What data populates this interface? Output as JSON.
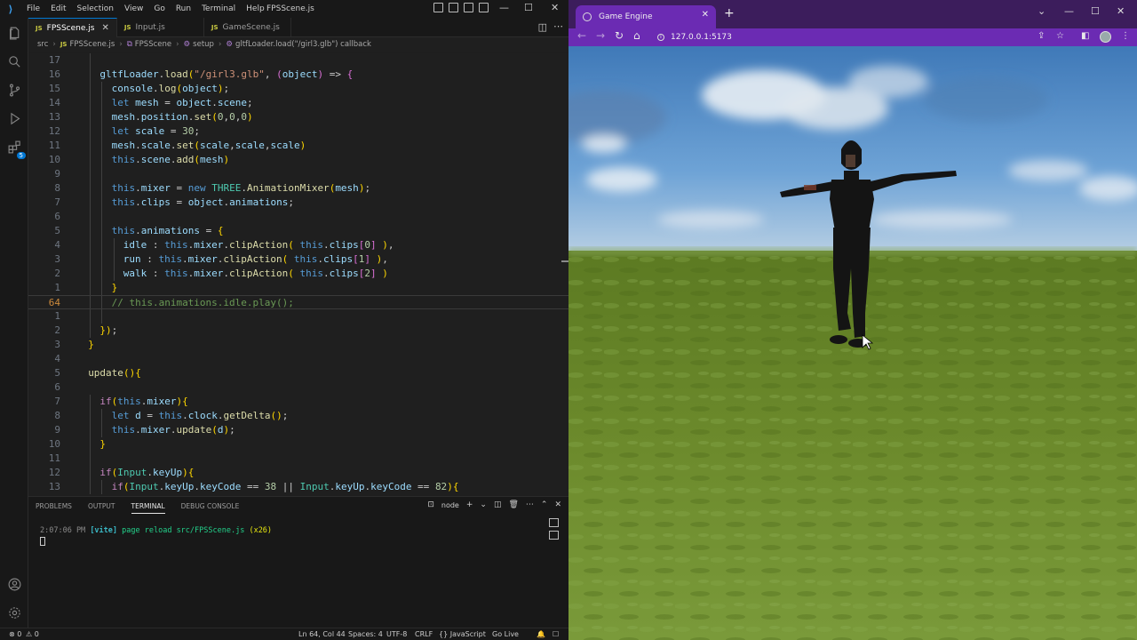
{
  "vscode": {
    "menu": [
      "File",
      "Edit",
      "Selection",
      "View",
      "Go",
      "Run",
      "Terminal",
      "Help"
    ],
    "window_title": "FPSScene.js",
    "tabs": [
      {
        "icon": "JS",
        "label": "FPSScene.js",
        "close": "✕"
      },
      {
        "icon": "JS",
        "label": "Input.js"
      },
      {
        "icon": "JS",
        "label": "GameScene.js"
      }
    ],
    "breadcrumb": {
      "folder": "src",
      "file_icon": "JS",
      "file": "FPSScene.js",
      "class": "FPSScene",
      "method": "setup",
      "callback": "gltfLoader.load(\"/girl3.glb\") callback"
    },
    "activity_badge": "5",
    "code_lines": [
      {
        "ln": "17",
        "indent": 3,
        "text": ""
      },
      {
        "ln": "16",
        "indent": 3,
        "text": "gltfLoader.load(\"/girl3.glb\", (object) => {"
      },
      {
        "ln": "15",
        "indent": 4,
        "text": "console.log(object);"
      },
      {
        "ln": "14",
        "indent": 4,
        "text": "let mesh = object.scene;"
      },
      {
        "ln": "13",
        "indent": 4,
        "text": "mesh.position.set(0,0,0)"
      },
      {
        "ln": "12",
        "indent": 4,
        "text": "let scale = 30;"
      },
      {
        "ln": "11",
        "indent": 4,
        "text": "mesh.scale.set(scale,scale,scale)"
      },
      {
        "ln": "10",
        "indent": 4,
        "text": "this.scene.add(mesh)"
      },
      {
        "ln": "9",
        "indent": 4,
        "text": ""
      },
      {
        "ln": "8",
        "indent": 4,
        "text": "this.mixer = new THREE.AnimationMixer(mesh);"
      },
      {
        "ln": "7",
        "indent": 4,
        "text": "this.clips = object.animations;"
      },
      {
        "ln": "6",
        "indent": 4,
        "text": ""
      },
      {
        "ln": "5",
        "indent": 4,
        "text": "this.animations = {"
      },
      {
        "ln": "4",
        "indent": 5,
        "text": "idle : this.mixer.clipAction( this.clips[0] ),"
      },
      {
        "ln": "3",
        "indent": 5,
        "text": "run : this.mixer.clipAction( this.clips[1] ),"
      },
      {
        "ln": "2",
        "indent": 5,
        "text": "walk : this.mixer.clipAction( this.clips[2] )"
      },
      {
        "ln": "1",
        "indent": 4,
        "text": "}"
      },
      {
        "ln": "64",
        "indent": 4,
        "text": "// this.animations.idle.play();",
        "current": true
      },
      {
        "ln": "1",
        "indent": 4,
        "text": ""
      },
      {
        "ln": "2",
        "indent": 3,
        "text": "});"
      },
      {
        "ln": "3",
        "indent": 2,
        "text": "}"
      },
      {
        "ln": "4",
        "indent": 0,
        "text": ""
      },
      {
        "ln": "5",
        "indent": 2,
        "text": "update(){"
      },
      {
        "ln": "6",
        "indent": 2,
        "text": ""
      },
      {
        "ln": "7",
        "indent": 3,
        "text": "if(this.mixer){"
      },
      {
        "ln": "8",
        "indent": 4,
        "text": "let d = this.clock.getDelta();"
      },
      {
        "ln": "9",
        "indent": 4,
        "text": "this.mixer.update(d);"
      },
      {
        "ln": "10",
        "indent": 3,
        "text": "}"
      },
      {
        "ln": "11",
        "indent": 3,
        "text": ""
      },
      {
        "ln": "12",
        "indent": 3,
        "text": "if(Input.keyUp){"
      },
      {
        "ln": "13",
        "indent": 4,
        "text": "if(Input.keyUp.keyCode == 38 || Input.keyUp.keyCode == 82){"
      }
    ],
    "panel": {
      "tabs": [
        "PROBLEMS",
        "OUTPUT",
        "TERMINAL",
        "DEBUG CONSOLE"
      ],
      "active_tab": "TERMINAL",
      "shell": "node",
      "terminal": {
        "time": "2:07:06 PM",
        "tag": "[vite]",
        "message": "page reload src/FPSScene.js",
        "count": "(x26)"
      }
    },
    "status": {
      "errors": "⊗ 0",
      "warnings": "⚠ 0",
      "position": "Ln 64, Col 44",
      "spaces": "Spaces: 4",
      "encoding": "UTF-8",
      "eol": "CRLF",
      "language": "{} JavaScript",
      "golive": "Go Live"
    }
  },
  "browser": {
    "tab_title": "Game Engine",
    "url": "127.0.0.1:5173",
    "colors": {
      "frame": "#3c1d5c",
      "toolbar": "#6b2bb3"
    }
  },
  "colors": {
    "editor_bg": "#1f1f1f",
    "keyword": "#569cd6",
    "function": "#dcdcaa",
    "string": "#ce9178",
    "comment": "#6a9955",
    "sky": "#4a86c6",
    "grass": "#6c8a2c"
  }
}
